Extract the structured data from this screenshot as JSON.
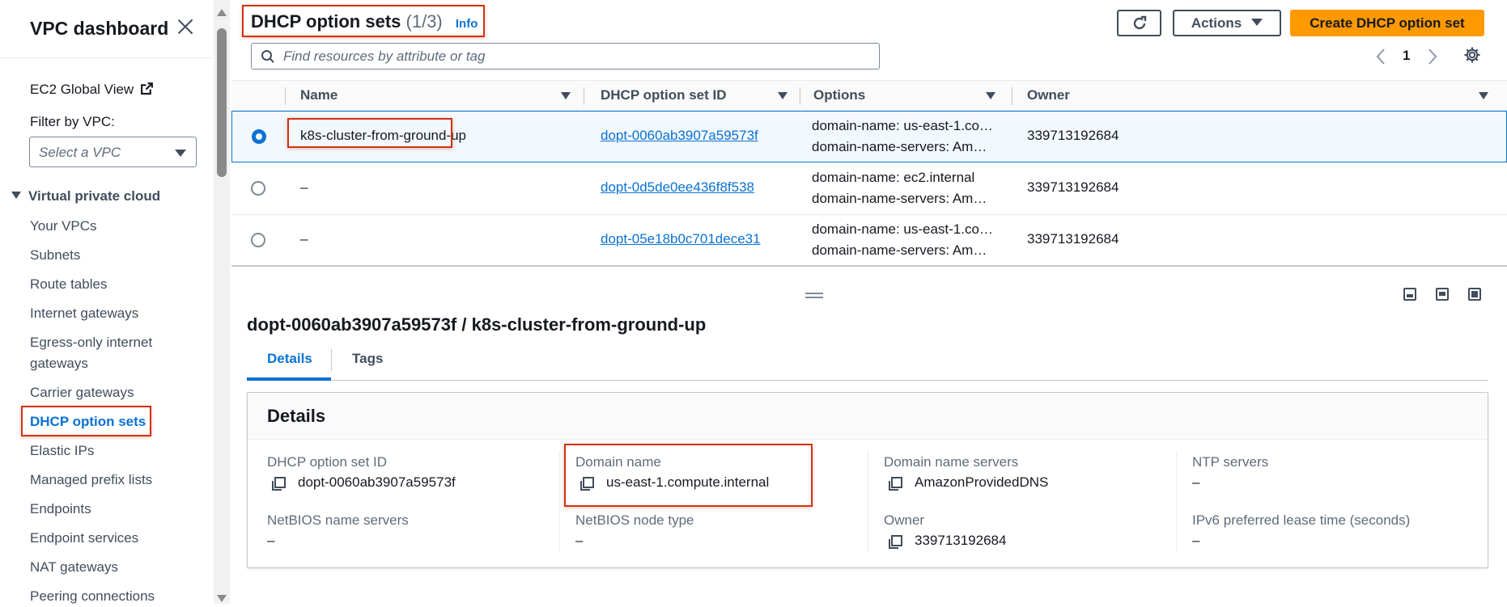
{
  "sidebar": {
    "title": "VPC dashboard",
    "ec2_global_view": "EC2 Global View",
    "filter_label": "Filter by VPC:",
    "filter_placeholder": "Select a VPC",
    "section": "Virtual private cloud",
    "items": [
      {
        "label": "Your VPCs"
      },
      {
        "label": "Subnets"
      },
      {
        "label": "Route tables"
      },
      {
        "label": "Internet gateways"
      },
      {
        "label": "Egress-only internet"
      },
      {
        "label": "gateways"
      },
      {
        "label": "Carrier gateways"
      },
      {
        "label": "DHCP option sets"
      },
      {
        "label": "Elastic IPs"
      },
      {
        "label": "Managed prefix lists"
      },
      {
        "label": "Endpoints"
      },
      {
        "label": "Endpoint services"
      },
      {
        "label": "NAT gateways"
      },
      {
        "label": "Peering connections"
      }
    ]
  },
  "header": {
    "title": "DHCP option sets",
    "count": "(1/3)",
    "info": "Info",
    "actions_label": "Actions",
    "create_label": "Create DHCP option set",
    "search_placeholder": "Find resources by attribute or tag",
    "page": "1"
  },
  "table": {
    "columns": [
      "Name",
      "DHCP option set ID",
      "Options",
      "Owner"
    ],
    "rows": [
      {
        "name": "k8s-cluster-from-ground-up",
        "id": "dopt-0060ab3907a59573f",
        "opt1": "domain-name: us-east-1.co…",
        "opt2": "domain-name-servers: Am…",
        "owner": "339713192684",
        "selected": true
      },
      {
        "name": "–",
        "id": "dopt-0d5de0ee436f8f538",
        "opt1": "domain-name: ec2.internal",
        "opt2": "domain-name-servers: Am…",
        "owner": "339713192684",
        "selected": false
      },
      {
        "name": "–",
        "id": "dopt-05e18b0c701dece31",
        "opt1": "domain-name: us-east-1.co…",
        "opt2": "domain-name-servers: Am…",
        "owner": "339713192684",
        "selected": false
      }
    ]
  },
  "details": {
    "title": "dopt-0060ab3907a59573f / k8s-cluster-from-ground-up",
    "tabs": [
      "Details",
      "Tags"
    ],
    "card_title": "Details",
    "fields": [
      {
        "label": "DHCP option set ID",
        "value": "dopt-0060ab3907a59573f"
      },
      {
        "label": "Domain name",
        "value": "us-east-1.compute.internal"
      },
      {
        "label": "Domain name servers",
        "value": "AmazonProvidedDNS"
      },
      {
        "label": "NTP servers",
        "value": "–"
      },
      {
        "label": "NetBIOS name servers",
        "value": "–"
      },
      {
        "label": "NetBIOS node type",
        "value": "–"
      },
      {
        "label": "Owner",
        "value": "339713192684"
      },
      {
        "label": "IPv6 preferred lease time (seconds)",
        "value": "–"
      }
    ]
  },
  "colors": {
    "accent": "#0972d3",
    "primary_button": "#ff9900",
    "highlight": "#d13212"
  },
  "icons": [
    "close-icon",
    "external-link-icon",
    "search-icon",
    "refresh-icon",
    "settings-icon",
    "copy-icon"
  ]
}
